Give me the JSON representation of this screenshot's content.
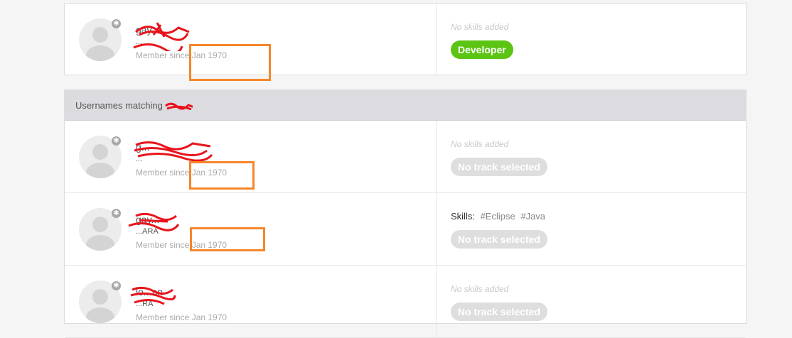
{
  "top_card": {
    "username": "gay...",
    "fullname": "...",
    "member_since": "Member since Jan 1970",
    "no_skills": "No skills added",
    "track": "Developer"
  },
  "list": {
    "header": "Usernames matching",
    "rows": [
      {
        "username": "g...",
        "fullname": "...",
        "member_since": "Member since Jan 1970",
        "skills_text": "No skills added",
        "track": "No track selected"
      },
      {
        "username": "gay...",
        "fullname": "...ARA",
        "member_since": "Member since Jan 1970",
        "skills_label": "Skills:",
        "skills": [
          "#Eclipse",
          "#Java"
        ],
        "track": "No track selected"
      },
      {
        "username": "lo...an",
        "fullname": "...RA",
        "member_since": "Member since Jan 1970",
        "skills_text": "No skills added",
        "track": "No track selected"
      }
    ]
  },
  "colors": {
    "developer_pill": "#5cc413",
    "highlight_box": "#f5862a",
    "redaction": "#e8141c"
  }
}
